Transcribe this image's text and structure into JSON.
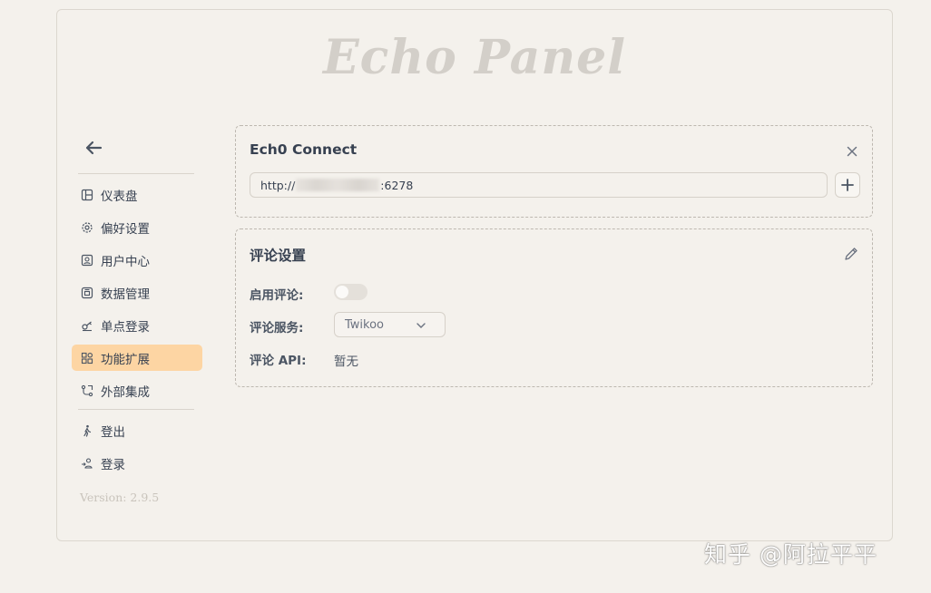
{
  "app": {
    "title": "Echo Panel",
    "version": "Version: 2.9.5"
  },
  "sidebar": {
    "items": [
      {
        "label": "仪表盘",
        "icon": "dashboard-icon"
      },
      {
        "label": "偏好设置",
        "icon": "gear-icon"
      },
      {
        "label": "用户中心",
        "icon": "user-icon"
      },
      {
        "label": "数据管理",
        "icon": "database-icon"
      },
      {
        "label": "单点登录",
        "icon": "key-icon"
      },
      {
        "label": "功能扩展",
        "icon": "extension-icon",
        "active": true
      },
      {
        "label": "外部集成",
        "icon": "integration-icon"
      }
    ],
    "auth": [
      {
        "label": "登出",
        "icon": "walk-icon"
      },
      {
        "label": "登录",
        "icon": "login-icon"
      }
    ]
  },
  "connect": {
    "title": "Ech0 Connect",
    "url_prefix": "http://",
    "url_suffix": ":6278"
  },
  "comments": {
    "title": "评论设置",
    "enable_label": "启用评论:",
    "enabled": false,
    "service_label": "评论服务:",
    "service_value": "Twikoo",
    "api_label": "评论 API:",
    "api_value": "暂无"
  },
  "watermark": "知乎 @阿拉平平",
  "colors": {
    "active_bg": "#fdd5a3",
    "background": "#f4f1ec",
    "border": "#bdb8b0"
  }
}
